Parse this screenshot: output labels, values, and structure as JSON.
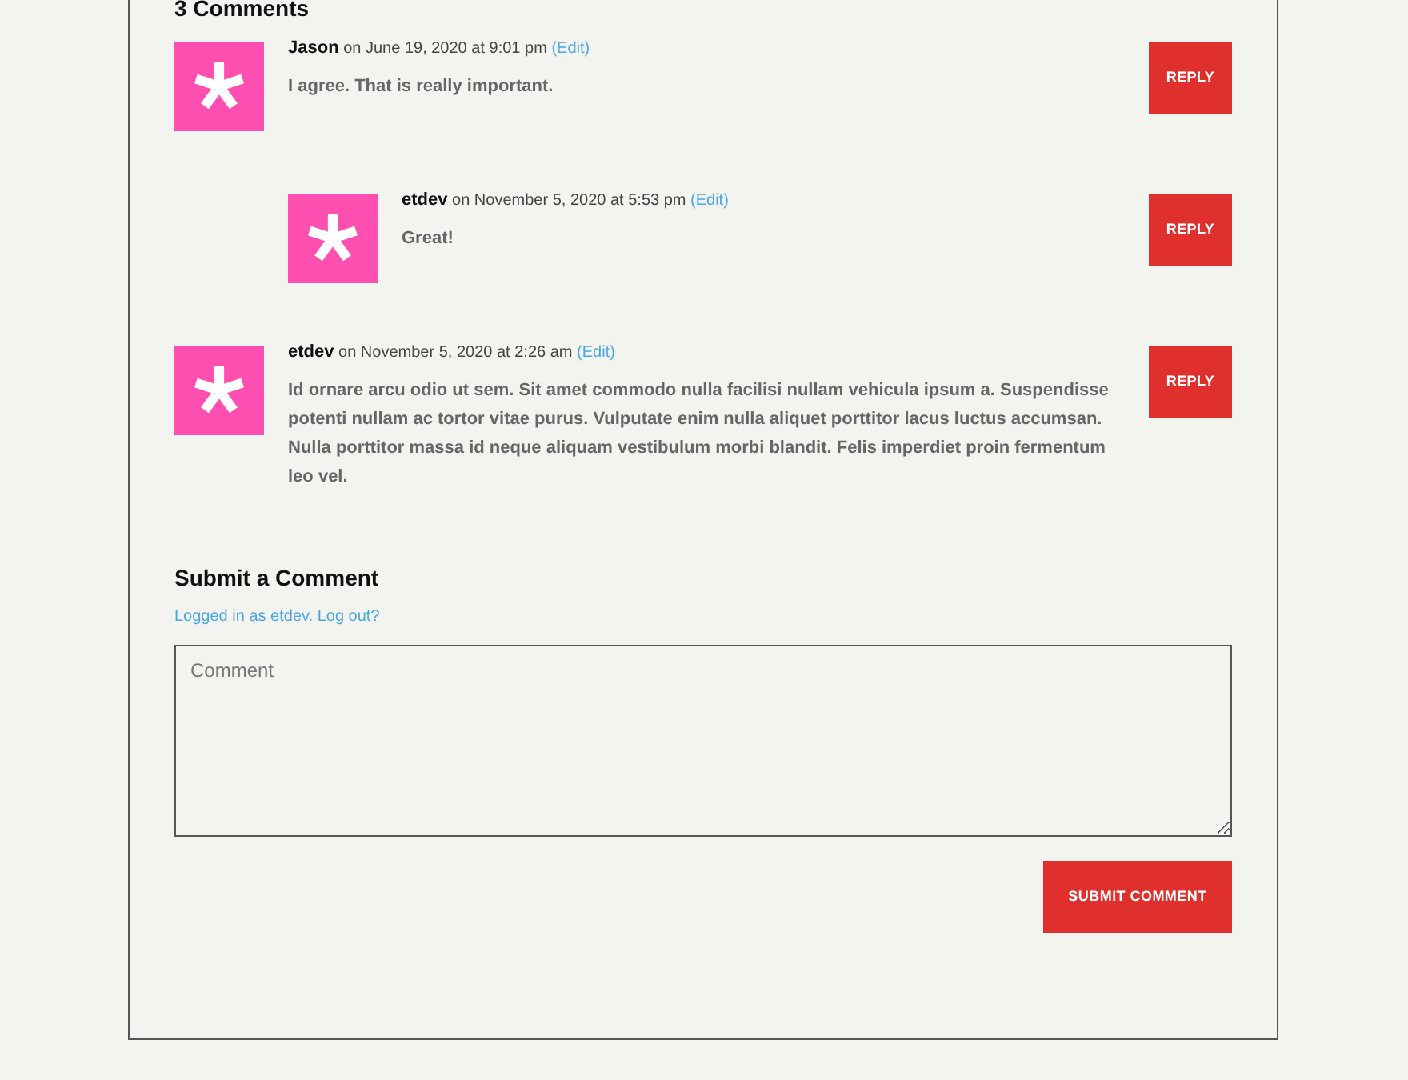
{
  "comments_title": "3 Comments",
  "comments": [
    {
      "author": "Jason",
      "meta": "on June 19, 2020 at 9:01 pm",
      "edit": "(Edit)",
      "body": "I agree. That is really important.",
      "reply": "REPLY",
      "children": [
        {
          "author": "etdev",
          "meta": "on November 5, 2020 at 5:53 pm",
          "edit": "(Edit)",
          "body": "Great!",
          "reply": "REPLY"
        }
      ]
    },
    {
      "author": "etdev",
      "meta": "on November 5, 2020 at 2:26 am",
      "edit": "(Edit)",
      "body": "Id ornare arcu odio ut sem. Sit amet commodo nulla facilisi nullam vehicula ipsum a. Suspendisse potenti nullam ac tortor vitae purus. Vulputate enim nulla aliquet porttitor lacus luctus accumsan. Nulla porttitor massa id neque aliquam vestibulum morbi blandit. Felis imperdiet proin fermentum leo vel.",
      "reply": "REPLY"
    }
  ],
  "form": {
    "title": "Submit a Comment",
    "logged_in": "Logged in as etdev.",
    "logout": "Log out?",
    "comment": {
      "placeholder": "Comment"
    },
    "submit": "SUBMIT COMMENT"
  }
}
